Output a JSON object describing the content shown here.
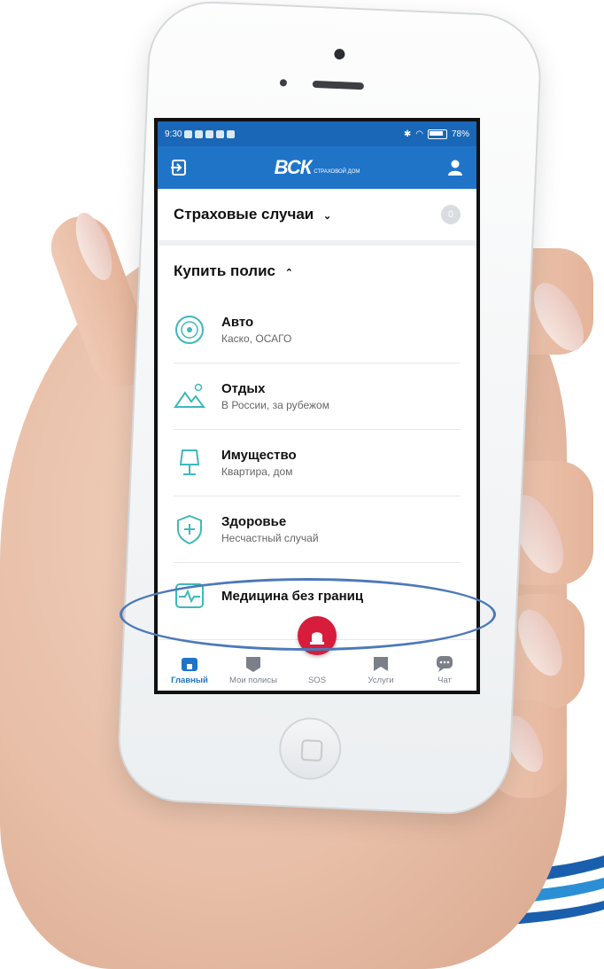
{
  "colors": {
    "brand_blue": "#1f74c8",
    "status_blue": "#1a67b7",
    "teal_icon": "#3fb8bd",
    "sos_red": "#d71d3b",
    "highlight": "#4c79b8"
  },
  "status_bar": {
    "time": "9:30",
    "battery": "78%"
  },
  "app_bar": {
    "logo_main": "ВСК",
    "logo_sub": "СТРАХОВОЙ ДОМ",
    "left_icon": "login-arrow-icon",
    "right_icon": "profile-icon"
  },
  "claims": {
    "label": "Страховые случаи",
    "count": "0"
  },
  "buy": {
    "label": "Купить полис",
    "items": [
      {
        "title": "Авто",
        "subtitle": "Каско, ОСАГО",
        "icon": "wheel-icon"
      },
      {
        "title": "Отдых",
        "subtitle": "В России, за рубежом",
        "icon": "mountains-icon"
      },
      {
        "title": "Имущество",
        "subtitle": "Квартира, дом",
        "icon": "lamp-icon"
      },
      {
        "title": "Здоровье",
        "subtitle": "Несчастный случай",
        "icon": "shield-cross-icon"
      },
      {
        "title": "Медицина без границ",
        "subtitle": "",
        "icon": "pulse-icon"
      }
    ]
  },
  "tabs": [
    {
      "label": "Главный",
      "icon": "home-icon",
      "active": true
    },
    {
      "label": "Мои полисы",
      "icon": "policy-icon",
      "active": false
    },
    {
      "label": "SOS",
      "icon": "sos-icon",
      "active": false
    },
    {
      "label": "Услуги",
      "icon": "bookmark-icon",
      "active": false
    },
    {
      "label": "Чат",
      "icon": "chat-icon",
      "active": false
    }
  ]
}
